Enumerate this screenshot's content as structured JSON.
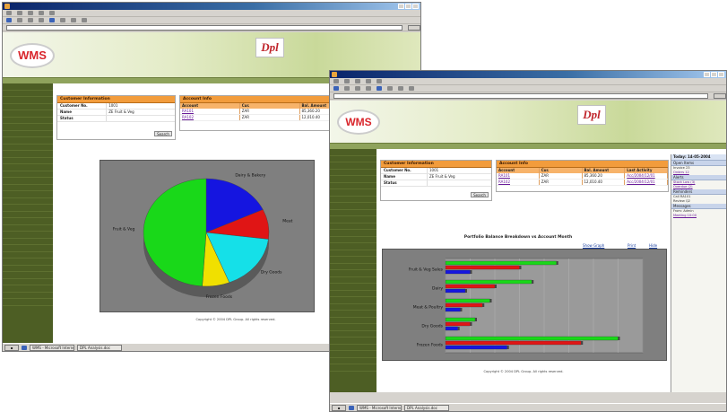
{
  "window1": {
    "logo": "WMS",
    "brand": "Dpl",
    "customer_panel": {
      "title": "Customer Information",
      "fields": [
        {
          "label": "Customer No.",
          "value": "1001"
        },
        {
          "label": "Name",
          "value": "ZE Fruit & Veg"
        },
        {
          "label": "Status",
          "value": ""
        }
      ],
      "button": "Search"
    },
    "account_panel": {
      "title": "Account Info",
      "columns": [
        "Account",
        "Cur.",
        "Bal. Amount",
        "Last Activity"
      ],
      "rows": [
        [
          "RA101",
          "ZAR",
          "85,360.20",
          "Acc/2004/12/01"
        ],
        [
          "RA102",
          "ZAR",
          "12,010.40",
          "Acc/2004/12/01"
        ]
      ]
    },
    "pie_labels": [
      "Fruit & Veg",
      "Dairy & Bakery",
      "Meat",
      "Dry Goods",
      "Frozen Foods"
    ],
    "footer": "Copyright © 2004 DPL Group. All rights reserved.",
    "task_items": [
      "WMS - Microsoft Internet...",
      "DPL Analysis.doc"
    ]
  },
  "window2": {
    "logo": "WMS",
    "brand": "Dpl",
    "customer_panel": {
      "title": "Customer Information",
      "fields": [
        {
          "label": "Customer No.",
          "value": "1001"
        },
        {
          "label": "Name",
          "value": "ZE Fruit & Veg"
        },
        {
          "label": "Status",
          "value": ""
        }
      ],
      "button": "Search"
    },
    "account_panel": {
      "title": "Account Info",
      "columns": [
        "Account",
        "Cur.",
        "Bal. Amount",
        "Last Activity"
      ],
      "rows": [
        [
          "RA101",
          "ZAR",
          "85,360.20",
          "Acc/2004/12/01"
        ],
        [
          "RA102",
          "ZAR",
          "12,010.40",
          "Acc/2004/12/01"
        ]
      ]
    },
    "chart_title": "Portfolio Balance Breakdown vs Account Month",
    "chart_links": [
      "Show Graph",
      "Print",
      "Hide"
    ],
    "bar_categories": [
      "Fruit & Veg Sales",
      "Dairy",
      "Meat & Poultry",
      "Dry Goods",
      "Frozen Foods"
    ],
    "right_panel": {
      "header": "Today: 14-05-2004",
      "sections": [
        {
          "title": "Open Items",
          "lines": [
            "Invoice 23",
            "Orders 12"
          ]
        },
        {
          "title": "Alerts",
          "lines": [
            "Stock Low (3)",
            "Overdue (2)"
          ]
        },
        {
          "title": "Reminders",
          "lines": [
            "Call RA101",
            "Review Q2"
          ]
        },
        {
          "title": "Messages",
          "lines": [
            "From: Admin",
            "Meeting 10:00"
          ]
        }
      ]
    },
    "footer": "Copyright © 2004 DPL Group. All rights reserved.",
    "task_items": [
      "WMS - Microsoft Internet...",
      "DPL Analysis.doc"
    ]
  },
  "chart_data": [
    {
      "type": "pie",
      "categories": [
        "Dairy & Bakery",
        "Meat",
        "Dry Goods",
        "Frozen Foods",
        "Fruit & Veg"
      ],
      "values": [
        18,
        9,
        17,
        7,
        49
      ],
      "colors": [
        "#1515e0",
        "#e01515",
        "#15e0e8",
        "#f0e000",
        "#19d819"
      ]
    },
    {
      "type": "bar",
      "orientation": "horizontal",
      "categories": [
        "Fruit & Veg Sales",
        "Dairy",
        "Meat & Poultry",
        "Dry Goods",
        "Frozen Foods"
      ],
      "series": [
        {
          "values": [
            45,
            35,
            18,
            12,
            70
          ],
          "color": "#19d819"
        },
        {
          "values": [
            30,
            20,
            15,
            10,
            55
          ],
          "color": "#e01515"
        },
        {
          "values": [
            10,
            8,
            6,
            5,
            25
          ],
          "color": "#1515e0"
        }
      ]
    }
  ]
}
